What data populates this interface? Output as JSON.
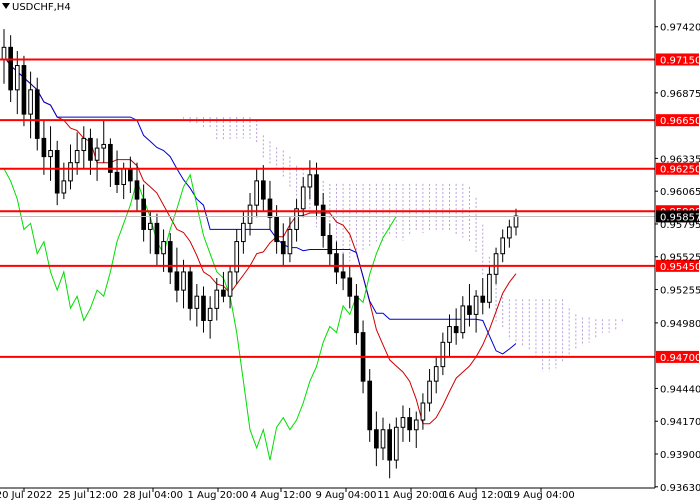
{
  "window": {
    "title": "USDCHF,H4",
    "menu_icon": "triangle-down-icon"
  },
  "colors": {
    "background": "#ffffff",
    "candle": "#000000",
    "level_line": "#ff0000",
    "level_tag_bg": "#ff0000",
    "level_tag_text": "#ffffff",
    "tenkan": "#cc0000",
    "kijun": "#0000cc",
    "chikou": "#00dd00",
    "kumo_bull": "#e8a070",
    "kumo_bear": "#b8a0d8",
    "bid_line": "#c0c0c0",
    "bid_tag_bg": "#000000"
  },
  "chart_data": {
    "type": "candlestick",
    "symbol": "USDCHF",
    "timeframe": "H4",
    "ylim": [
      0.9362,
      0.9764
    ],
    "price_ticks": [
      "0.97420",
      "0.96875",
      "0.96335",
      "0.96065",
      "0.95795",
      "0.95525",
      "0.95255",
      "0.94980",
      "0.94440",
      "0.94170",
      "0.93900",
      "0.93630"
    ],
    "x_ticks": [
      "20 Jul 2022",
      "25 Jul 12:00",
      "28 Jul 04:00",
      "1 Aug 20:00",
      "4 Aug 12:00",
      "9 Aug 04:00",
      "11 Aug 20:00",
      "16 Aug 12:00",
      "19 Aug 04:00"
    ],
    "levels": [
      "0.97150",
      "0.96650",
      "0.96250",
      "0.95900",
      "0.95450",
      "0.94700"
    ],
    "current_price": "0.95857",
    "candles": [
      [
        0.9715,
        0.974,
        0.9695,
        0.9725
      ],
      [
        0.9725,
        0.9735,
        0.968,
        0.969
      ],
      [
        0.969,
        0.9722,
        0.967,
        0.971
      ],
      [
        0.971,
        0.9718,
        0.966,
        0.967
      ],
      [
        0.967,
        0.9705,
        0.965,
        0.969
      ],
      [
        0.969,
        0.97,
        0.964,
        0.965
      ],
      [
        0.965,
        0.9665,
        0.962,
        0.9635
      ],
      [
        0.9635,
        0.966,
        0.9615,
        0.964
      ],
      [
        0.964,
        0.9648,
        0.9595,
        0.9605
      ],
      [
        0.9605,
        0.963,
        0.96,
        0.9615
      ],
      [
        0.9615,
        0.9645,
        0.9608,
        0.963
      ],
      [
        0.963,
        0.9655,
        0.962,
        0.964
      ],
      [
        0.964,
        0.966,
        0.9625,
        0.965
      ],
      [
        0.965,
        0.9658,
        0.962,
        0.9632
      ],
      [
        0.9632,
        0.965,
        0.9615,
        0.9642
      ],
      [
        0.9642,
        0.9665,
        0.963,
        0.9645
      ],
      [
        0.9645,
        0.965,
        0.961,
        0.9622
      ],
      [
        0.9622,
        0.964,
        0.9605,
        0.9612
      ],
      [
        0.9612,
        0.963,
        0.96,
        0.9625
      ],
      [
        0.9625,
        0.9635,
        0.9605,
        0.9615
      ],
      [
        0.9615,
        0.963,
        0.959,
        0.96
      ],
      [
        0.96,
        0.9612,
        0.9565,
        0.9575
      ],
      [
        0.9575,
        0.959,
        0.9555,
        0.958
      ],
      [
        0.958,
        0.9588,
        0.9545,
        0.9555
      ],
      [
        0.9555,
        0.9575,
        0.954,
        0.9565
      ],
      [
        0.9565,
        0.9572,
        0.953,
        0.954
      ],
      [
        0.954,
        0.956,
        0.9515,
        0.9525
      ],
      [
        0.9525,
        0.955,
        0.951,
        0.954
      ],
      [
        0.954,
        0.9545,
        0.95,
        0.951
      ],
      [
        0.951,
        0.953,
        0.9495,
        0.952
      ],
      [
        0.952,
        0.9528,
        0.949,
        0.95
      ],
      [
        0.95,
        0.952,
        0.9485,
        0.951
      ],
      [
        0.951,
        0.9535,
        0.95,
        0.9525
      ],
      [
        0.9525,
        0.954,
        0.9515,
        0.952
      ],
      [
        0.952,
        0.9545,
        0.951,
        0.954
      ],
      [
        0.954,
        0.9575,
        0.953,
        0.9565
      ],
      [
        0.9565,
        0.959,
        0.9555,
        0.958
      ],
      [
        0.958,
        0.9605,
        0.957,
        0.9595
      ],
      [
        0.9595,
        0.9625,
        0.9585,
        0.9615
      ],
      [
        0.9615,
        0.9628,
        0.959,
        0.96
      ],
      [
        0.96,
        0.9615,
        0.9575,
        0.9585
      ],
      [
        0.9585,
        0.9595,
        0.9555,
        0.9565
      ],
      [
        0.9565,
        0.958,
        0.9545,
        0.9555
      ],
      [
        0.9555,
        0.9585,
        0.9548,
        0.9575
      ],
      [
        0.9575,
        0.96,
        0.9565,
        0.9592
      ],
      [
        0.9592,
        0.9618,
        0.9585,
        0.961
      ],
      [
        0.961,
        0.9632,
        0.96,
        0.962
      ],
      [
        0.962,
        0.963,
        0.9585,
        0.9595
      ],
      [
        0.9595,
        0.9605,
        0.956,
        0.957
      ],
      [
        0.957,
        0.958,
        0.9545,
        0.9555
      ],
      [
        0.9555,
        0.9565,
        0.953,
        0.954
      ],
      [
        0.954,
        0.9555,
        0.9525,
        0.9535
      ],
      [
        0.9535,
        0.9545,
        0.951,
        0.952
      ],
      [
        0.952,
        0.953,
        0.948,
        0.949
      ],
      [
        0.949,
        0.95,
        0.944,
        0.945
      ],
      [
        0.945,
        0.946,
        0.94,
        0.941
      ],
      [
        0.941,
        0.9425,
        0.938,
        0.9395
      ],
      [
        0.9395,
        0.942,
        0.9385,
        0.941
      ],
      [
        0.941,
        0.9415,
        0.937,
        0.9385
      ],
      [
        0.9385,
        0.942,
        0.9378,
        0.9412
      ],
      [
        0.9412,
        0.943,
        0.94,
        0.942
      ],
      [
        0.942,
        0.9428,
        0.94,
        0.941
      ],
      [
        0.941,
        0.9425,
        0.9395,
        0.9418
      ],
      [
        0.9418,
        0.944,
        0.941,
        0.9432
      ],
      [
        0.9432,
        0.946,
        0.9425,
        0.945
      ],
      [
        0.945,
        0.947,
        0.944,
        0.9462
      ],
      [
        0.9462,
        0.949,
        0.9455,
        0.9482
      ],
      [
        0.9482,
        0.9505,
        0.947,
        0.9495
      ],
      [
        0.9495,
        0.951,
        0.948,
        0.949
      ],
      [
        0.949,
        0.952,
        0.9485,
        0.9512
      ],
      [
        0.9512,
        0.953,
        0.9495,
        0.9505
      ],
      [
        0.9505,
        0.9525,
        0.949,
        0.952
      ],
      [
        0.952,
        0.9535,
        0.9505,
        0.9515
      ],
      [
        0.9515,
        0.9545,
        0.951,
        0.9538
      ],
      [
        0.9538,
        0.956,
        0.953,
        0.9555
      ],
      [
        0.9555,
        0.9575,
        0.9548,
        0.9568
      ],
      [
        0.9568,
        0.9583,
        0.956,
        0.9577
      ],
      [
        0.9577,
        0.9592,
        0.957,
        0.9586
      ]
    ]
  }
}
